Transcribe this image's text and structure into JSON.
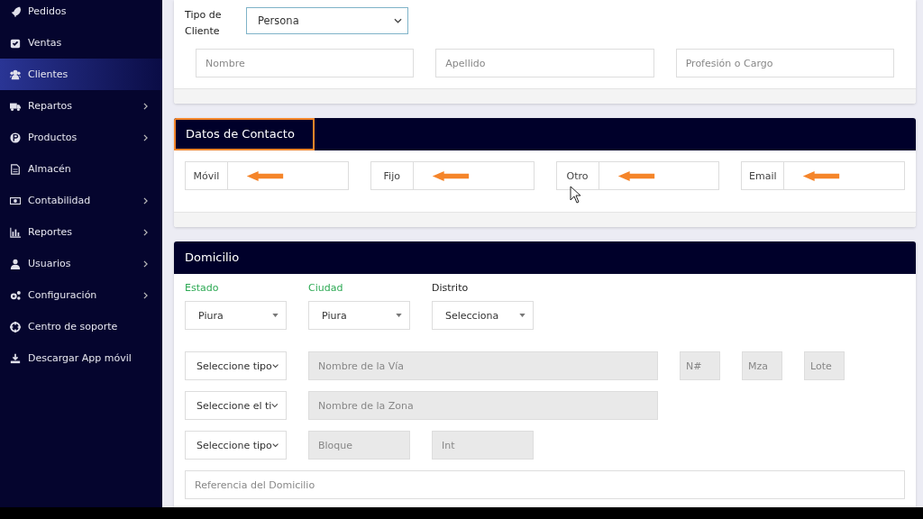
{
  "sidebar": {
    "items": [
      {
        "label": "Pedidos",
        "selected": false,
        "has_submenu": false
      },
      {
        "label": "Ventas",
        "selected": false,
        "has_submenu": false
      },
      {
        "label": "Clientes",
        "selected": true,
        "has_submenu": false
      },
      {
        "label": "Repartos",
        "selected": false,
        "has_submenu": true
      },
      {
        "label": "Productos",
        "selected": false,
        "has_submenu": true
      },
      {
        "label": "Almacén",
        "selected": false,
        "has_submenu": false
      },
      {
        "label": "Contabilidad",
        "selected": false,
        "has_submenu": true
      },
      {
        "label": "Reportes",
        "selected": false,
        "has_submenu": true
      },
      {
        "label": "Usuarios",
        "selected": false,
        "has_submenu": true
      },
      {
        "label": "Configuración",
        "selected": false,
        "has_submenu": true
      },
      {
        "label": "Centro de soporte",
        "selected": false,
        "has_submenu": false
      },
      {
        "label": "Descargar App móvil",
        "selected": false,
        "has_submenu": false
      }
    ]
  },
  "client_card": {
    "type_label": "Tipo de Cliente",
    "type_value": "Persona",
    "fields": [
      {
        "placeholder": "Nombre"
      },
      {
        "placeholder": "Apellido"
      },
      {
        "placeholder": "Profesión o Cargo"
      }
    ]
  },
  "contact_card": {
    "title": "Datos de Contacto",
    "highlighted": true,
    "fields": [
      {
        "label": "Móvil",
        "arrow": true
      },
      {
        "label": "Fijo",
        "arrow": true
      },
      {
        "label": "Otro",
        "arrow": true
      },
      {
        "label": "Email",
        "arrow": true
      }
    ]
  },
  "address_card": {
    "title": "Domicilio",
    "selects": [
      {
        "label": "Estado",
        "value": "Piura",
        "valid": true
      },
      {
        "label": "Ciudad",
        "value": "Piura",
        "valid": true
      },
      {
        "label": "Distrito",
        "value": "Selecciona",
        "valid": false
      }
    ],
    "rows": [
      [
        {
          "kind": "select",
          "value": "Seleccione tipo"
        },
        {
          "kind": "input",
          "placeholder": "Nombre de la Vía",
          "disabled": true
        },
        {
          "kind": "input",
          "placeholder": "N#",
          "disabled": true
        },
        {
          "kind": "input",
          "placeholder": "Mza",
          "disabled": true
        },
        {
          "kind": "input",
          "placeholder": "Lote",
          "disabled": true
        }
      ],
      [
        {
          "kind": "select",
          "value": "Seleccione el ti"
        },
        {
          "kind": "input",
          "placeholder": "Nombre de la Zona",
          "disabled": true
        }
      ],
      [
        {
          "kind": "select",
          "value": "Seleccione tipo"
        },
        {
          "kind": "input",
          "placeholder": "Bloque",
          "disabled": true
        },
        {
          "kind": "input",
          "placeholder": "Int",
          "disabled": true
        }
      ],
      [
        {
          "kind": "input",
          "placeholder": "Referencia del Domicilio",
          "disabled": false
        }
      ]
    ]
  },
  "cursor": {
    "visible": true
  }
}
